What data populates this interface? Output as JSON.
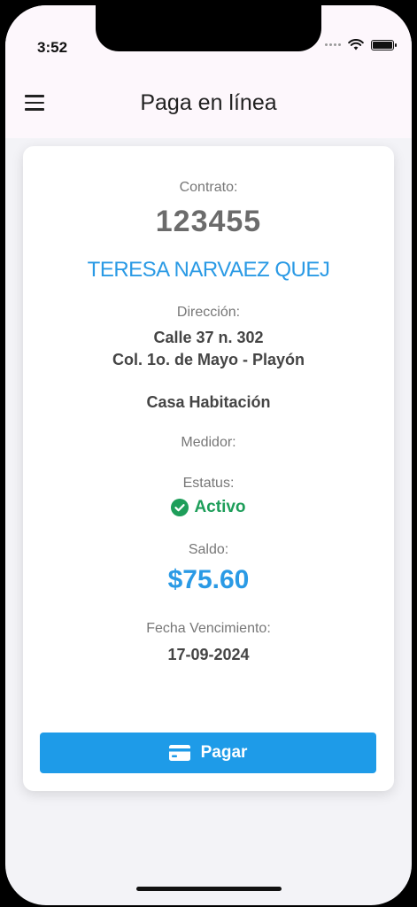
{
  "status_bar": {
    "time": "3:52"
  },
  "app_bar": {
    "title": "Paga en línea",
    "menu_icon": "hamburger-menu-icon"
  },
  "account": {
    "contract_label": "Contrato:",
    "contract_number": "123455",
    "holder_name": "TERESA NARVAEZ QUEJ",
    "address_label": "Dirección:",
    "address_line1": "Calle 37 n. 302",
    "address_line2": "Col. 1o. de Mayo - Playón",
    "property_type": "Casa Habitación",
    "meter_label": "Medidor:",
    "status_label": "Estatus:",
    "status_value": "Activo",
    "status_icon": "check-circle-icon",
    "balance_label": "Saldo:",
    "balance_value": "$75.60",
    "due_date_label": "Fecha Vencimiento:",
    "due_date_value": "17-09-2024"
  },
  "actions": {
    "pay_label": "Pagar",
    "pay_icon": "credit-card-icon"
  },
  "colors": {
    "accent_blue": "#1e9be8",
    "status_green": "#1e9e5a",
    "header_bg": "#fdf7fc"
  }
}
